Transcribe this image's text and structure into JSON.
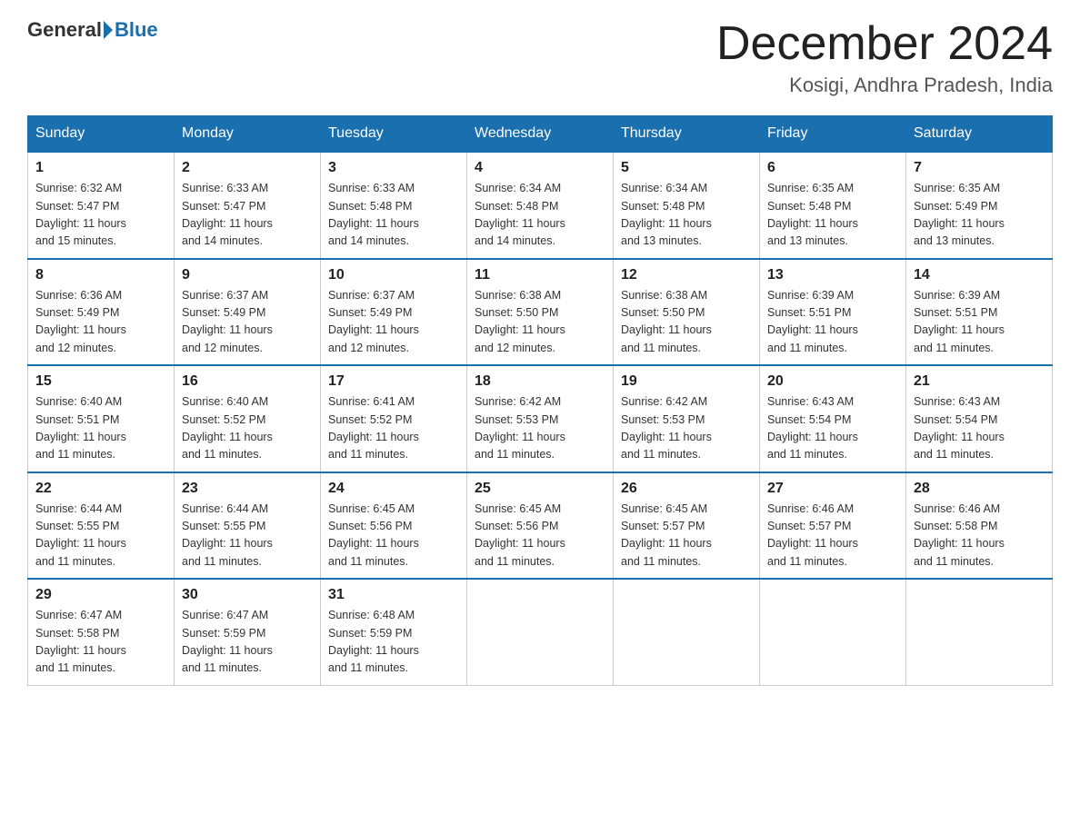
{
  "header": {
    "logo": {
      "general": "General",
      "blue": "Blue"
    },
    "title": "December 2024",
    "location": "Kosigi, Andhra Pradesh, India"
  },
  "days_of_week": [
    "Sunday",
    "Monday",
    "Tuesday",
    "Wednesday",
    "Thursday",
    "Friday",
    "Saturday"
  ],
  "weeks": [
    [
      {
        "day": "1",
        "sunrise": "6:32 AM",
        "sunset": "5:47 PM",
        "daylight": "11 hours and 15 minutes."
      },
      {
        "day": "2",
        "sunrise": "6:33 AM",
        "sunset": "5:47 PM",
        "daylight": "11 hours and 14 minutes."
      },
      {
        "day": "3",
        "sunrise": "6:33 AM",
        "sunset": "5:48 PM",
        "daylight": "11 hours and 14 minutes."
      },
      {
        "day": "4",
        "sunrise": "6:34 AM",
        "sunset": "5:48 PM",
        "daylight": "11 hours and 14 minutes."
      },
      {
        "day": "5",
        "sunrise": "6:34 AM",
        "sunset": "5:48 PM",
        "daylight": "11 hours and 13 minutes."
      },
      {
        "day": "6",
        "sunrise": "6:35 AM",
        "sunset": "5:48 PM",
        "daylight": "11 hours and 13 minutes."
      },
      {
        "day": "7",
        "sunrise": "6:35 AM",
        "sunset": "5:49 PM",
        "daylight": "11 hours and 13 minutes."
      }
    ],
    [
      {
        "day": "8",
        "sunrise": "6:36 AM",
        "sunset": "5:49 PM",
        "daylight": "11 hours and 12 minutes."
      },
      {
        "day": "9",
        "sunrise": "6:37 AM",
        "sunset": "5:49 PM",
        "daylight": "11 hours and 12 minutes."
      },
      {
        "day": "10",
        "sunrise": "6:37 AM",
        "sunset": "5:49 PM",
        "daylight": "11 hours and 12 minutes."
      },
      {
        "day": "11",
        "sunrise": "6:38 AM",
        "sunset": "5:50 PM",
        "daylight": "11 hours and 12 minutes."
      },
      {
        "day": "12",
        "sunrise": "6:38 AM",
        "sunset": "5:50 PM",
        "daylight": "11 hours and 11 minutes."
      },
      {
        "day": "13",
        "sunrise": "6:39 AM",
        "sunset": "5:51 PM",
        "daylight": "11 hours and 11 minutes."
      },
      {
        "day": "14",
        "sunrise": "6:39 AM",
        "sunset": "5:51 PM",
        "daylight": "11 hours and 11 minutes."
      }
    ],
    [
      {
        "day": "15",
        "sunrise": "6:40 AM",
        "sunset": "5:51 PM",
        "daylight": "11 hours and 11 minutes."
      },
      {
        "day": "16",
        "sunrise": "6:40 AM",
        "sunset": "5:52 PM",
        "daylight": "11 hours and 11 minutes."
      },
      {
        "day": "17",
        "sunrise": "6:41 AM",
        "sunset": "5:52 PM",
        "daylight": "11 hours and 11 minutes."
      },
      {
        "day": "18",
        "sunrise": "6:42 AM",
        "sunset": "5:53 PM",
        "daylight": "11 hours and 11 minutes."
      },
      {
        "day": "19",
        "sunrise": "6:42 AM",
        "sunset": "5:53 PM",
        "daylight": "11 hours and 11 minutes."
      },
      {
        "day": "20",
        "sunrise": "6:43 AM",
        "sunset": "5:54 PM",
        "daylight": "11 hours and 11 minutes."
      },
      {
        "day": "21",
        "sunrise": "6:43 AM",
        "sunset": "5:54 PM",
        "daylight": "11 hours and 11 minutes."
      }
    ],
    [
      {
        "day": "22",
        "sunrise": "6:44 AM",
        "sunset": "5:55 PM",
        "daylight": "11 hours and 11 minutes."
      },
      {
        "day": "23",
        "sunrise": "6:44 AM",
        "sunset": "5:55 PM",
        "daylight": "11 hours and 11 minutes."
      },
      {
        "day": "24",
        "sunrise": "6:45 AM",
        "sunset": "5:56 PM",
        "daylight": "11 hours and 11 minutes."
      },
      {
        "day": "25",
        "sunrise": "6:45 AM",
        "sunset": "5:56 PM",
        "daylight": "11 hours and 11 minutes."
      },
      {
        "day": "26",
        "sunrise": "6:45 AM",
        "sunset": "5:57 PM",
        "daylight": "11 hours and 11 minutes."
      },
      {
        "day": "27",
        "sunrise": "6:46 AM",
        "sunset": "5:57 PM",
        "daylight": "11 hours and 11 minutes."
      },
      {
        "day": "28",
        "sunrise": "6:46 AM",
        "sunset": "5:58 PM",
        "daylight": "11 hours and 11 minutes."
      }
    ],
    [
      {
        "day": "29",
        "sunrise": "6:47 AM",
        "sunset": "5:58 PM",
        "daylight": "11 hours and 11 minutes."
      },
      {
        "day": "30",
        "sunrise": "6:47 AM",
        "sunset": "5:59 PM",
        "daylight": "11 hours and 11 minutes."
      },
      {
        "day": "31",
        "sunrise": "6:48 AM",
        "sunset": "5:59 PM",
        "daylight": "11 hours and 11 minutes."
      },
      null,
      null,
      null,
      null
    ]
  ],
  "labels": {
    "sunrise": "Sunrise:",
    "sunset": "Sunset:",
    "daylight": "Daylight:"
  }
}
